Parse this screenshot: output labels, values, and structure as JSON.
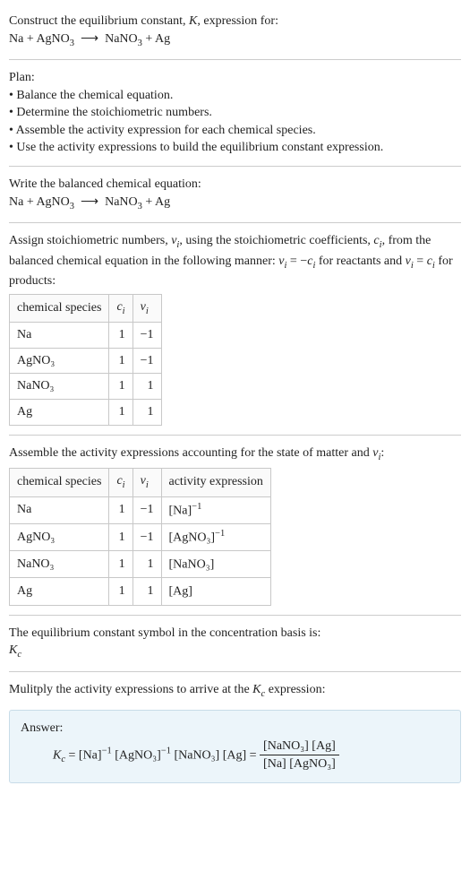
{
  "intro": {
    "line1": "Construct the equilibrium constant, ",
    "Kital": "K",
    "line1b": ", expression for:",
    "eq": "Na + AgNO",
    "eq_sub": "3",
    "arrow": "⟶",
    "eq2": "NaNO",
    "eq2_sub": "3",
    "eq3": " + Ag"
  },
  "plan": {
    "title": "Plan:",
    "b1": "• Balance the chemical equation.",
    "b2": "• Determine the stoichiometric numbers.",
    "b3": "• Assemble the activity expression for each chemical species.",
    "b4": "• Use the activity expressions to build the equilibrium constant expression."
  },
  "balanced": {
    "text": "Write the balanced chemical equation:",
    "eq": "Na + AgNO",
    "eq_sub": "3",
    "arrow": "⟶",
    "eq2": "NaNO",
    "eq2_sub": "3",
    "eq3": " + Ag"
  },
  "stoich": {
    "text1": "Assign stoichiometric numbers, ",
    "nu": "ν",
    "i": "i",
    "text2": ", using the stoichiometric coefficients, ",
    "c": "c",
    "text3": ", from the balanced chemical equation in the following manner: ",
    "eqrel1": " = −",
    "text4": " for reactants and ",
    "eqrel2": " = ",
    "text5": " for products:",
    "headers": {
      "h1": "chemical species",
      "h2": "cᵢ",
      "h3": "νᵢ"
    },
    "rows": [
      {
        "sp": "Na",
        "c": "1",
        "v": "−1"
      },
      {
        "sp": "AgNO₃",
        "c": "1",
        "v": "−1"
      },
      {
        "sp": "NaNO₃",
        "c": "1",
        "v": "1"
      },
      {
        "sp": "Ag",
        "c": "1",
        "v": "1"
      }
    ]
  },
  "activity": {
    "text": "Assemble the activity expressions accounting for the state of matter and ",
    "nu": "ν",
    "i": "i",
    "colon": ":",
    "headers": {
      "h1": "chemical species",
      "h2": "cᵢ",
      "h3": "νᵢ",
      "h4": "activity expression"
    },
    "rows": [
      {
        "sp": "Na",
        "c": "1",
        "v": "−1",
        "ae_base": "[Na]",
        "ae_sup": "−1"
      },
      {
        "sp": "AgNO₃",
        "c": "1",
        "v": "−1",
        "ae_base": "[AgNO₃]",
        "ae_sup": "−1"
      },
      {
        "sp": "NaNO₃",
        "c": "1",
        "v": "1",
        "ae_base": "[NaNO₃]",
        "ae_sup": ""
      },
      {
        "sp": "Ag",
        "c": "1",
        "v": "1",
        "ae_base": "[Ag]",
        "ae_sup": ""
      }
    ]
  },
  "kcbasis": {
    "text": "The equilibrium constant symbol in the concentration basis is:",
    "sym": "K",
    "sub": "c"
  },
  "multiply": {
    "text": "Mulitply the activity expressions to arrive at the ",
    "sym": "K",
    "sub": "c",
    "text2": " expression:"
  },
  "answer": {
    "label": "Answer:",
    "lhs": "K",
    "lhs_sub": "c",
    "eq": " = [Na]",
    "p1": "−1",
    "eq2": " [AgNO₃]",
    "p2": "−1",
    "eq3": " [NaNO₃] [Ag] = ",
    "num": "[NaNO₃] [Ag]",
    "den": "[Na] [AgNO₃]"
  },
  "chart_data": {
    "type": "table",
    "tables": [
      {
        "title": "stoichiometric numbers",
        "columns": [
          "chemical species",
          "c_i",
          "ν_i"
        ],
        "rows": [
          [
            "Na",
            1,
            -1
          ],
          [
            "AgNO3",
            1,
            -1
          ],
          [
            "NaNO3",
            1,
            1
          ],
          [
            "Ag",
            1,
            1
          ]
        ]
      },
      {
        "title": "activity expressions",
        "columns": [
          "chemical species",
          "c_i",
          "ν_i",
          "activity expression"
        ],
        "rows": [
          [
            "Na",
            1,
            -1,
            "[Na]^-1"
          ],
          [
            "AgNO3",
            1,
            -1,
            "[AgNO3]^-1"
          ],
          [
            "NaNO3",
            1,
            1,
            "[NaNO3]"
          ],
          [
            "Ag",
            1,
            1,
            "[Ag]"
          ]
        ]
      }
    ]
  }
}
